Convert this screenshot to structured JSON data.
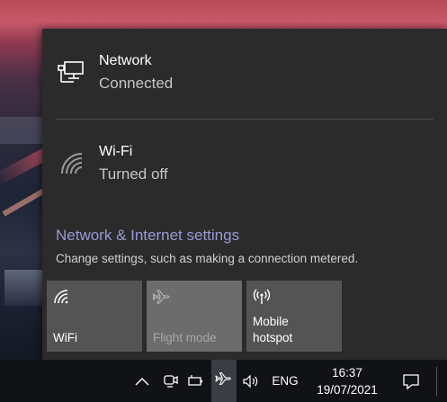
{
  "flyout": {
    "network": {
      "title": "Network",
      "status": "Connected",
      "icon": "ethernet-monitor-icon"
    },
    "wifi": {
      "title": "Wi-Fi",
      "status": "Turned off",
      "icon": "wifi-off-icon"
    },
    "settings_link": "Network & Internet settings",
    "settings_desc": "Change settings, such as making a connection metered.",
    "tiles": [
      {
        "label": "WiFi",
        "icon": "wifi-icon",
        "state": "off"
      },
      {
        "label": "Flight mode",
        "icon": "airplane-icon",
        "state": "disabled"
      },
      {
        "label_line1": "Mobile",
        "label_line2": "hotspot",
        "icon": "hotspot-icon",
        "state": "off"
      }
    ]
  },
  "taskbar": {
    "language": "ENG",
    "time": "16:37",
    "date": "19/07/2021",
    "tray_icons": [
      "chevron-up-icon",
      "meet-now-icon",
      "battery-icon",
      "airplane-icon",
      "volume-icon"
    ],
    "notification_icon": "action-center-icon"
  },
  "colors": {
    "flyout_bg": "#2b2b2b",
    "tile_bg": "#545454",
    "tile_disabled_bg": "#6c6c6c",
    "link": "#9a9ad8",
    "taskbar_bg": "#101216"
  }
}
